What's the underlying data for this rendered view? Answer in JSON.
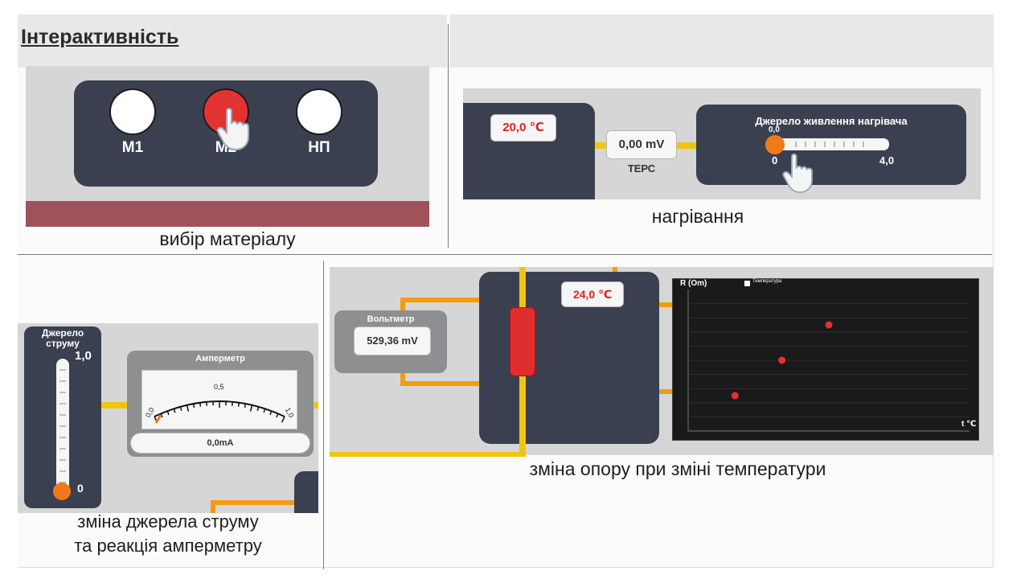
{
  "title": "Інтерактивність",
  "material_panel": {
    "buttons": [
      {
        "label": "М1",
        "active": false
      },
      {
        "label": "М2",
        "active": true
      },
      {
        "label": "НП",
        "active": false
      }
    ],
    "caption": "вибір матеріалу"
  },
  "heating_panel": {
    "temperature": "20,0 ℃",
    "terps_value": "0,00 mV",
    "terps_label": "ТЕРС",
    "heater_title": "Джерело живлення нагрівача",
    "slider_value": "0,0",
    "slider_min": "0",
    "slider_max": "4,0",
    "slider_level": 0,
    "caption": "нагрівання"
  },
  "current_panel": {
    "source_title": "Джерело струму",
    "source_max": "1,0",
    "source_min": "0",
    "source_level": 0,
    "ammeter_title": "Амперметр",
    "scale_labels": [
      "0,0",
      "0,5",
      "1,0"
    ],
    "ammeter_value": "0,0mA",
    "caption_line1": "зміна джерела струму",
    "caption_line2": "та реакція амперметру"
  },
  "resistance_panel": {
    "voltmeter_title": "Вольтметр",
    "voltmeter_value": "529,36 mV",
    "temperature": "24,0 ℃",
    "caption": "зміна опору при зміні температури"
  },
  "chart_data": {
    "type": "scatter",
    "title": "",
    "ylabel": "R (Om)",
    "xlabel": "t ℃",
    "legend": [
      "Температура"
    ],
    "legend_position": "top",
    "points": [
      {
        "x": 1,
        "y": 1
      },
      {
        "x": 2,
        "y": 2
      },
      {
        "x": 3,
        "y": 3
      }
    ],
    "colors": {
      "point": "#e53030",
      "background": "#1a1a1a"
    }
  },
  "icons": {
    "pointer": "hand-pointer-icon"
  }
}
